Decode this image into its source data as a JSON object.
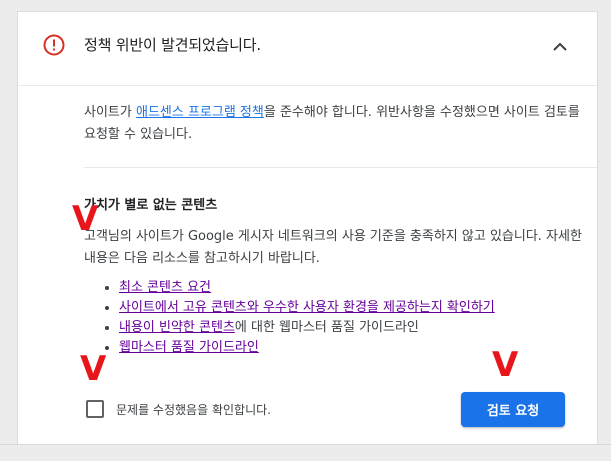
{
  "header": {
    "title": "정책 위반이 발견되었습니다."
  },
  "intro": {
    "prefix": "사이트가 ",
    "link": "애드센스 프로그램 정책",
    "suffix": "을 준수해야 합니다. 위반사항을 수정했으면 사이트 검토를 요청할 수 있습니다."
  },
  "section": {
    "title": "가치가 별로 없는 콘텐츠",
    "body": "고객님의 사이트가 Google 게시자 네트워크의 사용 기준을 충족하지 않고 있습니다. 자세한 내용은 다음 리소스를 참고하시기 바랍니다."
  },
  "links": [
    {
      "text": "최소 콘텐츠 요건",
      "suffix": ""
    },
    {
      "text": "사이트에서 고유 콘텐츠와 우수한 사용자 환경을 제공하는지 확인하기",
      "suffix": ""
    },
    {
      "text": "내용이 빈약한 콘텐츠",
      "suffix": "에 대한 웹마스터 품질 가이드라인"
    },
    {
      "text": "웹마스터 품질 가이드라인",
      "suffix": ""
    }
  ],
  "checkbox": {
    "label": "문제를 수정했음을 확인합니다.",
    "checked": false
  },
  "actions": {
    "review_label": "검토 요청"
  },
  "annotations": {
    "mark1": "V",
    "mark2": "V",
    "mark3": "V"
  },
  "colors": {
    "accent": "#1a73e8",
    "alert": "#d93025",
    "annotation": "#e8151b",
    "visited_link": "#660099"
  }
}
